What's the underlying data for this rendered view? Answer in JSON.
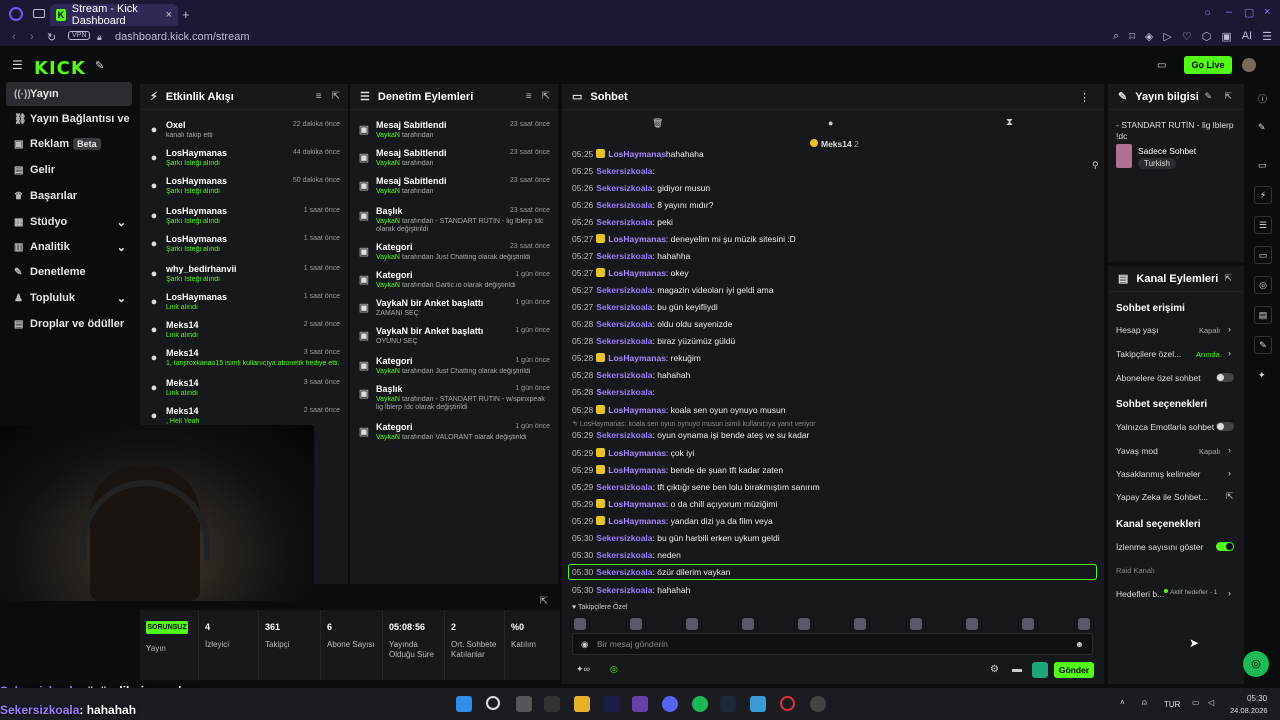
{
  "browser": {
    "tab_title": "Stream - Kick Dashboard",
    "url": "dashboard.kick.com/stream",
    "vpn": "VPN",
    "ai": "AI"
  },
  "header": {
    "logo": "KICK",
    "go_live": "Go Live"
  },
  "sidebar": {
    "items": [
      {
        "label": "Yayın",
        "icon": "stream-icon",
        "active": true
      },
      {
        "label": "Yayın Bağlantısı ve Anahtar",
        "icon": "link-icon"
      },
      {
        "label": "Reklam",
        "icon": "ads-icon",
        "badge": "Beta"
      },
      {
        "label": "Gelir",
        "icon": "money-icon"
      },
      {
        "label": "Başarılar",
        "icon": "trophy-icon"
      },
      {
        "label": "Stüdyo",
        "icon": "studio-icon",
        "chevron": true
      },
      {
        "label": "Analitik",
        "icon": "analytics-icon",
        "chevron": true
      },
      {
        "label": "Denetleme",
        "icon": "moderation-icon"
      },
      {
        "label": "Topluluk",
        "icon": "community-icon",
        "chevron": true
      },
      {
        "label": "Droplar ve ödüller",
        "icon": "drops-icon"
      }
    ]
  },
  "activity": {
    "title": "Etkinlik Akışı",
    "items": [
      {
        "user": "Oxel",
        "sub": "kanalı takip etti",
        "time": "22 dakika önce",
        "subGray": true
      },
      {
        "user": "LosHaymanas",
        "sub": "Şarkı İsteği alındı",
        "time": "44 dakika önce"
      },
      {
        "user": "LosHaymanas",
        "sub": "Şarkı İsteği alındı",
        "time": "50 dakika önce"
      },
      {
        "user": "LosHaymanas",
        "sub": "Şarkı İsteği alındı",
        "time": "1 saat önce"
      },
      {
        "user": "LosHaymanas",
        "sub": "Şarkı İsteği alındı",
        "time": "1 saat önce"
      },
      {
        "user": "why_bedirhanvii",
        "sub": "Şarkı İsteği alındı",
        "time": "1 saat önce"
      },
      {
        "user": "LosHaymanas",
        "sub": "Link alındı",
        "time": "1 saat önce"
      },
      {
        "user": "Meks14",
        "sub": "Link alındı",
        "time": "2 saat önce"
      },
      {
        "user": "Meks14",
        "sub": "1, tanjiroxkanao15 isimli kullanıcıya abonelik hediye etti.",
        "time": "3 saat önce"
      },
      {
        "user": "Meks14",
        "sub": "Link alındı",
        "time": "3 saat önce"
      },
      {
        "user": "Meks14",
        "sub": ", Hell Yeah",
        "time": "2 saat önce"
      }
    ]
  },
  "moderation": {
    "title": "Denetim Eylemleri",
    "items": [
      {
        "title": "Mesaj Sabitlendi",
        "who": "VaykaN",
        "rest": "tarafından",
        "time": "23 saat önce"
      },
      {
        "title": "Mesaj Sabitlendi",
        "who": "VaykaN",
        "rest": "tarafından",
        "time": "23 saat önce"
      },
      {
        "title": "Mesaj Sabitlendi",
        "who": "VaykaN",
        "rest": "tarafından",
        "time": "23 saat önce"
      },
      {
        "title": "Başlık",
        "who": "VaykaN",
        "rest": "tarafından - STANDART RUTİN - lig lblerp !dc",
        "line2": "olarak değiştirildi",
        "time": "23 saat önce"
      },
      {
        "title": "Kategori",
        "who": "VaykaN",
        "rest": "tarafından Just Chatting olarak değiştirildi",
        "time": "23 saat önce"
      },
      {
        "title": "Kategori",
        "who": "VaykaN",
        "rest": "tarafından Gartic.io olarak değiştirildi",
        "time": "1 gün önce"
      },
      {
        "title": "VaykaN bir Anket başlattı",
        "who": "",
        "rest": "",
        "line2": "ZAMANI SEÇ",
        "time": "1 gün önce"
      },
      {
        "title": "VaykaN bir Anket başlattı",
        "who": "",
        "rest": "",
        "line2": "OYUNU SEÇ",
        "time": "1 gün önce"
      },
      {
        "title": "Kategori",
        "who": "VaykaN",
        "rest": "tarafından Just Chatting olarak değiştirildi",
        "time": "1 gün önce"
      },
      {
        "title": "Başlık",
        "who": "VaykaN",
        "rest": "tarafından - STANDART RUTİN - w/spinxpeak",
        "line2": "lig lblerp !dc olarak değiştirildi",
        "time": "1 gün önce"
      },
      {
        "title": "Kategori",
        "who": "VaykaN",
        "rest": "tarafından VALORANT olarak değiştirildi",
        "time": "1 gün önce"
      }
    ]
  },
  "chat": {
    "title": "Sohbet",
    "pinned_user": "Meks14",
    "pinned_count": "2",
    "placeholder": "Bir mesaj gönderin",
    "send": "Gönder",
    "followers_only": "Takipçilere Özel",
    "messages": [
      {
        "t": "05:25",
        "u": "LosHaymanas",
        "m": "hahahaha",
        "badge": true
      },
      {
        "t": "05:25",
        "u": "Sekersizkoala",
        "m": ":"
      },
      {
        "t": "05:26",
        "u": "Sekersizkoala",
        "m": ": gidiyor musun"
      },
      {
        "t": "05:26",
        "u": "Sekersizkoala",
        "m": ": 8 yayını mıdır?"
      },
      {
        "t": "05:26",
        "u": "Sekersizkoala",
        "m": ": peki"
      },
      {
        "t": "05:27",
        "u": "LosHaymanas",
        "m": ": deneyelim mi şu müzik sitesini :D",
        "badge": true
      },
      {
        "t": "05:27",
        "u": "Sekersizkoala",
        "m": ": hahahha"
      },
      {
        "t": "05:27",
        "u": "LosHaymanas",
        "m": ": okey",
        "badge": true
      },
      {
        "t": "05:27",
        "u": "Sekersizkoala",
        "m": ": magazin videoları iyi geldi ama"
      },
      {
        "t": "05:27",
        "u": "Sekersizkoala",
        "m": ": bu gün keyifliydi"
      },
      {
        "t": "05:28",
        "u": "Sekersizkoala",
        "m": ": oldu oldu sayenizde"
      },
      {
        "t": "05:28",
        "u": "Sekersizkoala",
        "m": ": biraz yüzümüz güldü"
      },
      {
        "t": "05:28",
        "u": "LosHaymanas",
        "m": ": rekuğim",
        "badge": true
      },
      {
        "t": "05:28",
        "u": "Sekersizkoala",
        "m": ": hahahah"
      },
      {
        "t": "05:28",
        "u": "Sekersizkoala",
        "m": ":"
      },
      {
        "t": "05:28",
        "u": "LosHaymanas",
        "m": ": koala sen oyun oynuyo musun",
        "badge": true
      },
      {
        "t": "05:29",
        "u": "Sekersizkoala",
        "m": ": oyun oynama işi bende ateş ve su kadar"
      },
      {
        "t": "05:29",
        "u": "LosHaymanas",
        "m": ": çok iyi",
        "badge": true
      },
      {
        "t": "05:29",
        "u": "LosHaymanas",
        "m": ": bende de şuan tft kadar zaten",
        "badge": true
      },
      {
        "t": "05:29",
        "u": "Sekersizkoala",
        "m": ": tft çıktığı sene ben lolu bırakmıştım sanırım"
      },
      {
        "t": "05:29",
        "u": "LosHaymanas",
        "m": ": o da chill açıyorum müziğimi",
        "badge": true
      },
      {
        "t": "05:29",
        "u": "LosHaymanas",
        "m": ": yandan dizi ya da film veya",
        "badge": true
      },
      {
        "t": "05:30",
        "u": "Sekersizkoala",
        "m": ": bu gün harbili erken uykum geldi"
      },
      {
        "t": "05:30",
        "u": "Sekersizkoala",
        "m": ": neden"
      },
      {
        "t": "05:30",
        "u": "Sekersizkoala",
        "m": ": özür dilerim vaykan"
      },
      {
        "t": "05:30",
        "u": "Sekersizkoala",
        "m": ": hahahah"
      }
    ],
    "reply_note": "LosHaymanas: koala sen oyun oynuyo musun isimli kullanıcıya yanıt veriyor"
  },
  "stats": {
    "status": "SORUNSUZ",
    "status_label": "Yayın",
    "items": [
      {
        "v": "4",
        "l": "İzleyici"
      },
      {
        "v": "361",
        "l": "Takipçi"
      },
      {
        "v": "6",
        "l": "Abone Sayısı"
      },
      {
        "v": "05:08:56",
        "l": "Yayında Olduğu Süre"
      },
      {
        "v": "2",
        "l": "Ort. Sohbete Katılanlar"
      },
      {
        "v": "%0",
        "l": "Katılım"
      }
    ]
  },
  "stream_info": {
    "title": "Yayın bilgisi",
    "stream_title": "- STANDART RUTİN - lig lblerp !dc",
    "category": "Sadece Sohbet",
    "tag": "Turkish"
  },
  "channel_actions": {
    "title": "Kanal Eylemleri",
    "chat_access": "Sohbet erişimi",
    "account_age": "Hesap yaşı",
    "account_age_val": "Kapalı",
    "followers_only": "Takipçilere özel...",
    "followers_only_val": "Anında",
    "subs_only": "Abonelere özel sohbet",
    "chat_options": "Sohbet seçenekleri",
    "emotes_only": "Yalnızca Emotlarla sohbet",
    "slow_mode": "Yavaş mod",
    "slow_mode_val": "Kapalı",
    "banned_words": "Yasaklanmış kelimeler",
    "ai_chat": "Yapay Zeka ile Sohbet...",
    "channel_options": "Kanal seçenekleri",
    "show_viewers": "İzlenme sayısını göster",
    "raid": "Raid Kanalı",
    "goals": "Hedefleri b...",
    "goals_val": "Aktif hedefler - 1"
  },
  "overlay": {
    "line1_user": "Sekersizkoala",
    "line1_msg": ": özür dilerim vaykan",
    "line2_user": "Sekersizkoala",
    "line2_msg": ": hahahah"
  },
  "taskbar": {
    "lang": "TUR",
    "time": "05:30",
    "date": "24.08.2026"
  },
  "colors": {
    "accent": "#53fc18",
    "username": "#9a7cff",
    "panel": "#17181b"
  }
}
